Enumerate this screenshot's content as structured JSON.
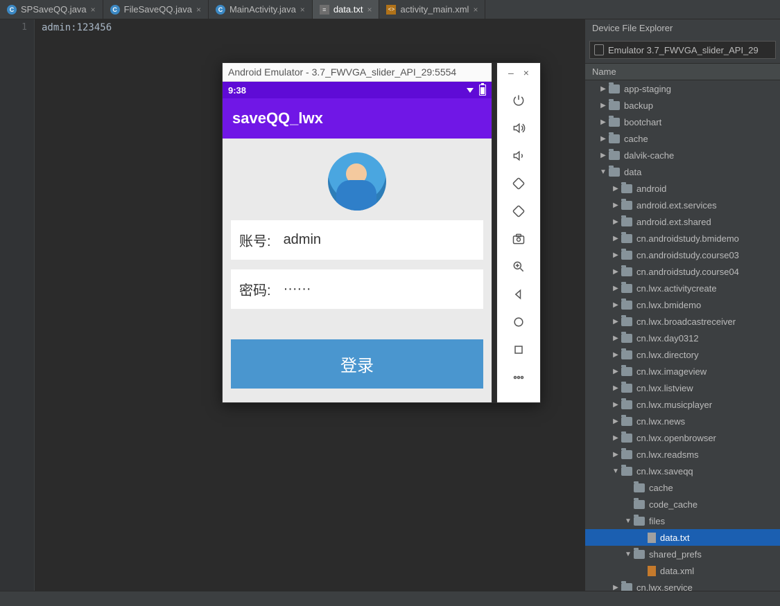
{
  "tabs": [
    {
      "label": "SPSaveQQ.java",
      "type": "java",
      "active": false
    },
    {
      "label": "FileSaveQQ.java",
      "type": "java",
      "active": false
    },
    {
      "label": "MainActivity.java",
      "type": "java",
      "active": false
    },
    {
      "label": "data.txt",
      "type": "txt",
      "active": true
    },
    {
      "label": "activity_main.xml",
      "type": "xml",
      "active": false
    }
  ],
  "editor": {
    "line_number": "1",
    "content": "admin:123456"
  },
  "panel": {
    "title": "Device File Explorer",
    "device": "Emulator 3.7_FWVGA_slider_API_29",
    "column": "Name"
  },
  "tree": [
    {
      "d": 1,
      "exp": "right",
      "k": "folder",
      "label": "app-staging"
    },
    {
      "d": 1,
      "exp": "right",
      "k": "folder",
      "label": "backup"
    },
    {
      "d": 1,
      "exp": "right",
      "k": "folder",
      "label": "bootchart"
    },
    {
      "d": 1,
      "exp": "right",
      "k": "folder",
      "label": "cache"
    },
    {
      "d": 1,
      "exp": "right",
      "k": "folder",
      "label": "dalvik-cache"
    },
    {
      "d": 1,
      "exp": "down",
      "k": "folder",
      "label": "data"
    },
    {
      "d": 2,
      "exp": "right",
      "k": "folder",
      "label": "android"
    },
    {
      "d": 2,
      "exp": "right",
      "k": "folder",
      "label": "android.ext.services"
    },
    {
      "d": 2,
      "exp": "right",
      "k": "folder",
      "label": "android.ext.shared"
    },
    {
      "d": 2,
      "exp": "right",
      "k": "folder",
      "label": "cn.androidstudy.bmidemo"
    },
    {
      "d": 2,
      "exp": "right",
      "k": "folder",
      "label": "cn.androidstudy.course03"
    },
    {
      "d": 2,
      "exp": "right",
      "k": "folder",
      "label": "cn.androidstudy.course04"
    },
    {
      "d": 2,
      "exp": "right",
      "k": "folder",
      "label": "cn.lwx.activitycreate"
    },
    {
      "d": 2,
      "exp": "right",
      "k": "folder",
      "label": "cn.lwx.bmidemo"
    },
    {
      "d": 2,
      "exp": "right",
      "k": "folder",
      "label": "cn.lwx.broadcastreceiver"
    },
    {
      "d": 2,
      "exp": "right",
      "k": "folder",
      "label": "cn.lwx.day0312"
    },
    {
      "d": 2,
      "exp": "right",
      "k": "folder",
      "label": "cn.lwx.directory"
    },
    {
      "d": 2,
      "exp": "right",
      "k": "folder",
      "label": "cn.lwx.imageview"
    },
    {
      "d": 2,
      "exp": "right",
      "k": "folder",
      "label": "cn.lwx.listview"
    },
    {
      "d": 2,
      "exp": "right",
      "k": "folder",
      "label": "cn.lwx.musicplayer"
    },
    {
      "d": 2,
      "exp": "right",
      "k": "folder",
      "label": "cn.lwx.news"
    },
    {
      "d": 2,
      "exp": "right",
      "k": "folder",
      "label": "cn.lwx.openbrowser"
    },
    {
      "d": 2,
      "exp": "right",
      "k": "folder",
      "label": "cn.lwx.readsms"
    },
    {
      "d": 2,
      "exp": "down",
      "k": "folder",
      "label": "cn.lwx.saveqq"
    },
    {
      "d": 3,
      "exp": "none",
      "k": "folder",
      "label": "cache"
    },
    {
      "d": 3,
      "exp": "none",
      "k": "folder",
      "label": "code_cache"
    },
    {
      "d": 3,
      "exp": "down",
      "k": "folder",
      "label": "files"
    },
    {
      "d": 4,
      "exp": "none",
      "k": "file-txt",
      "label": "data.txt",
      "selected": true
    },
    {
      "d": 3,
      "exp": "down",
      "k": "folder",
      "label": "shared_prefs"
    },
    {
      "d": 4,
      "exp": "none",
      "k": "file-xml",
      "label": "data.xml"
    },
    {
      "d": 2,
      "exp": "right",
      "k": "folder",
      "label": "cn.lwx.service"
    }
  ],
  "emulator": {
    "title": "Android Emulator - 3.7_FWVGA_slider_API_29:5554",
    "time": "9:38",
    "app_title": "saveQQ_lwx",
    "account_label": "账号:",
    "password_label": "密码:",
    "account_value": "admin",
    "password_value": "······",
    "login_label": "登录",
    "win_min": "–",
    "win_close": "×"
  }
}
